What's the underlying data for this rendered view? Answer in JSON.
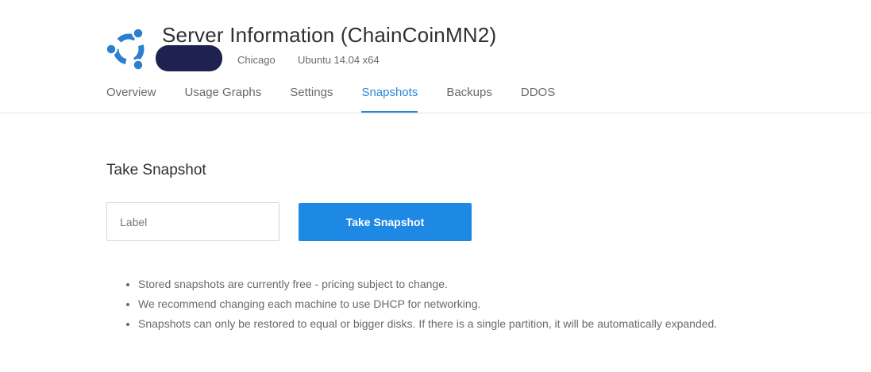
{
  "server": {
    "title": "Server Information (ChainCoinMN2)",
    "location": "Chicago",
    "os": "Ubuntu 14.04 x64"
  },
  "tabs": [
    {
      "label": "Overview",
      "active": false
    },
    {
      "label": "Usage Graphs",
      "active": false
    },
    {
      "label": "Settings",
      "active": false
    },
    {
      "label": "Snapshots",
      "active": true
    },
    {
      "label": "Backups",
      "active": false
    },
    {
      "label": "DDOS",
      "active": false
    }
  ],
  "snapshot": {
    "section_title": "Take Snapshot",
    "label_placeholder": "Label",
    "label_value": "",
    "button_label": "Take Snapshot"
  },
  "notes": [
    "Stored snapshots are currently free - pricing subject to change.",
    "We recommend changing each machine to use DHCP for networking.",
    "Snapshots can only be restored to equal or bigger disks. If there is a single partition, it will be automatically expanded."
  ],
  "colors": {
    "accent": "#1e88e5",
    "ubuntu_logo": "#2b7fd1",
    "redaction": "#1f2250"
  },
  "icons": {
    "os_logo": "ubuntu-logo-icon"
  }
}
